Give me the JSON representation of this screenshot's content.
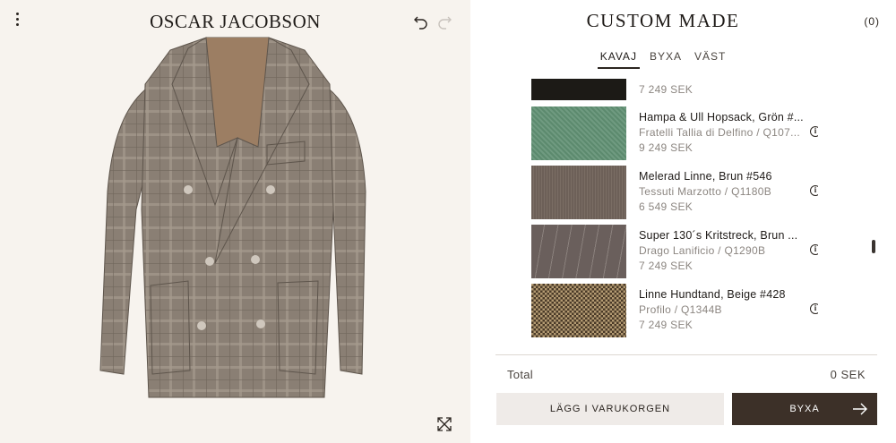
{
  "header": {
    "brand": "OSCAR JACOBSON",
    "title": "CUSTOM MADE",
    "cart_count": "(0)"
  },
  "tabs": [
    {
      "label": "KAVAJ",
      "active": true
    },
    {
      "label": "BYXA",
      "active": false
    },
    {
      "label": "VÄST",
      "active": false
    }
  ],
  "fabrics": [
    {
      "name": "",
      "maker": "",
      "price": "7 249 SEK",
      "swatch_color": "#1c1a16"
    },
    {
      "name": "Hampa & Ull Hopsack, Grön #...",
      "maker": "Fratelli Tallia di Delfino / Q107...",
      "price": "9 249 SEK",
      "swatch_color": "#5c8a6e"
    },
    {
      "name": "Melerad Linne, Brun #546",
      "maker": "Tessuti Marzotto / Q1180B",
      "price": "6 549 SEK",
      "swatch_color": "#6d6058"
    },
    {
      "name": "Super 130´s Kritstreck, Brun ...",
      "maker": "Drago Lanificio / Q1290B",
      "price": "7 249 SEK",
      "swatch_color": "#6a5f5c"
    },
    {
      "name": "Linne Hundtand, Beige #428",
      "maker": "Profilo / Q1344B",
      "price": "7 249 SEK",
      "swatch_color": "#8a7454"
    }
  ],
  "info_icon_glyph": "i",
  "summary": {
    "total_label": "Total",
    "total_value": "0 SEK"
  },
  "buttons": {
    "add_to_cart": "LÄGG I VARUKORGEN",
    "next": "BYXA"
  },
  "icons": {
    "menu": "kebab-menu-icon",
    "undo": "undo-icon",
    "redo": "redo-icon",
    "expand": "expand-icon",
    "info": "info-icon",
    "next": "arrow-right-icon"
  },
  "colors": {
    "accent_dark": "#3c3028",
    "left_bg": "#f7f3ee",
    "cart_button_bg": "#efebe8"
  }
}
